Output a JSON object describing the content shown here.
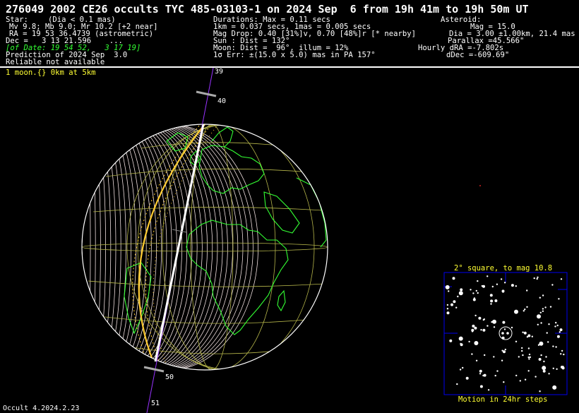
{
  "title": "276049 2002 CE26 occults TYC 485-03103-1 on 2024 Sep  6 from 19h 41m to 19h 50m UT",
  "star": {
    "header": "Star:",
    "dia": "(Dia < 0.1 mas)",
    "mags": "Mv 9.8; Mb 9.0; Mr 10.2 [+2 near]",
    "ra": "RA = 19 53 36.4739 (astrometric)",
    "dec": "Dec =   3 13 21.596    ...",
    "of_date": "[of Date: 19 54 52,   3 17 19]",
    "prediction": "Prediction of 2024 Sep  3.0",
    "reliable": "Reliable not available"
  },
  "event": {
    "durations": "Durations: Max = 0.11 secs",
    "km_secs": "1km = 0.037 secs, 1mas = 0.005 secs",
    "mag_drop": "Mag Drop: 0.40 [31%]v, 0.70 [48%]r [* nearby]",
    "sun": "Sun : Dist = 132°",
    "moon": "Moon: Dist =  96°, illum = 12%",
    "err": "1σ Err: ±(15.0 x 5.0) mas in PA 157°"
  },
  "asteroid": {
    "header": "Asteroid:",
    "mag": "Mag = 15.0",
    "dia": "Dia = 3.00 ±1.00km, 21.4 mas",
    "parallax": "Parallax =45.566\"",
    "dra": "Hourly dRA =-7.802s",
    "ddec": "dDec =-609.69\""
  },
  "moon_label": "1 moon.{} 0km at 5km",
  "path_ticks": [
    "39",
    "40",
    "50",
    "51"
  ],
  "starchart": {
    "title": "2° square, to mag 10.8",
    "caption": "Motion in 24hr steps"
  },
  "footer": "Occult 4.2024.2.23",
  "colors": {
    "background": "#000000",
    "land_outline": "#33ff33",
    "grid": "#b5b54a",
    "twilight": "#ffcc33",
    "path": "#ffffff",
    "track": "#9933ff",
    "chart_frame": "#0000ee",
    "chart_title": "#ffff33"
  }
}
